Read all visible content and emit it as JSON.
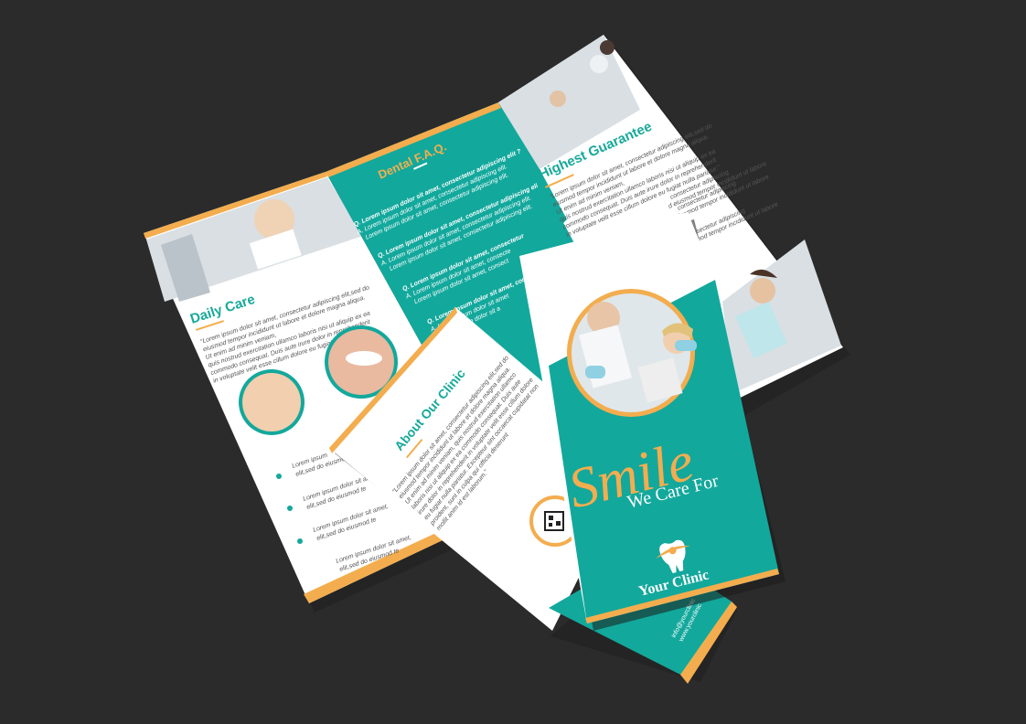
{
  "colors": {
    "teal": "#13a89c",
    "orange": "#f3ad4e",
    "background": "#2b2b2b",
    "paper": "#ffffff"
  },
  "outside_spread": {
    "daily_care": {
      "heading": "Daily Care",
      "body": [
        "“Lorem ipsum dolor sit amet, consectetur adipiscing elit,sed do",
        "eiusmod tempor incididunt ut labore et dolore magna aliqua.",
        "Ut enim ad minim veniam,",
        "quis nostrud exercitation ullamco laboris nisi ut aliquip ex ea",
        "commodo consequat. Duis aute irure dolor in reprehenderit",
        "in voluptate velit esse cillum dolore eu fugiat nulla pariatur.”"
      ],
      "bullets": [
        "Lorem ipsum",
        "elit,sed do eiusmod t",
        "Lorem ipsum dolor sit amet,",
        "elit,sed do eiusmod te",
        "Lorem ipsum dolor sit amet,",
        "elit,sed do eiusmod te",
        "Lorem ipsum dolor sit amet,",
        "elit,sed do eiusmod te"
      ]
    },
    "faq": {
      "heading": "Dental F.A.Q.",
      "lines": [
        "Q. Lorem ipsum dolor sit amet, consectetur adipiscing elit ?",
        "A. Lorem ipsum dolor sit amet, consectetur adipiscing elit.",
        "Lorem ipsum dolor sit amet, consectetur adipiscing elit.",
        "Q. Lorem ipsum dolor sit amet, consectetur adipiscing elit ?",
        "A. Lorem ipsum dolor sit amet, consectetur adipiscing elit.",
        "Lorem ipsum dolor sit amet, consectetur adipiscing elit.",
        "Q. Lorem ipsum dolor sit amet, consectetur",
        "A. Lorem ipsum dolor sit amet, consecte",
        "Lorem ipsum dolor sit amet, consect",
        "Q. Lorem ipsum dolor sit amet, consectetur",
        "A. Lorem ipsum dolor sit amet",
        "Lorem ipsum dolor sit a"
      ]
    },
    "guarantee": {
      "heading": "Highest Guarantee",
      "body": [
        "“Lorem ipsum dolor sit amet, consectetur adipiscing elit,sed do",
        "eiusmod tempor incididunt ut labore et dolore magna aliqua.",
        "Ut enim ad minim veniam,",
        "quis nostrud exercitation ullamco laboris nisi ut aliquip ex ea",
        "commodo consequat. Duis aute irure dolor in reprehenderit",
        "in voluptate velit esse cillum dolore eu fugiat nulla pariatur.”"
      ],
      "extra": [
        "consectetur adipiscing",
        "d eiusmod tempor incididunt ut labore",
        "consectetur adipiscing",
        "eiusmod tempor incididunt ut labore",
        "consectetur adipiscing",
        "eiusmod tempor incididunt ut labore"
      ]
    }
  },
  "about_panel": {
    "heading": "About Our Clinic",
    "body": [
      "“Lorem ipsum dolor sit amet, consectetur adipiscing elit,sed do",
      "eiusmod tempor incididunt ut labore et dolore magna aliqua.",
      "Ut enim ad minim veniam, quis nostrud exercitation ullamco",
      "laboris nisi ut aliquip ex ea commodo consequat. Duis aute",
      "irure dolor in reprehenderit in voluptate velit esse cillum dolore",
      "eu fugiat nulla pariatur. Excepteur sint occaecat cupidatat non",
      "proident, sunt in culpa qui officia deserunt",
      "mollit anim id est laborum.”"
    ]
  },
  "cover": {
    "title": "Smile",
    "tagline": "We Care For",
    "brand": "Your Clinic"
  },
  "back_panel": {
    "contact_lines": [
      "info@yourclinic",
      "www.yourclinic"
    ]
  },
  "icons": [
    "tooth-logo-icon",
    "qr-code-icon"
  ]
}
